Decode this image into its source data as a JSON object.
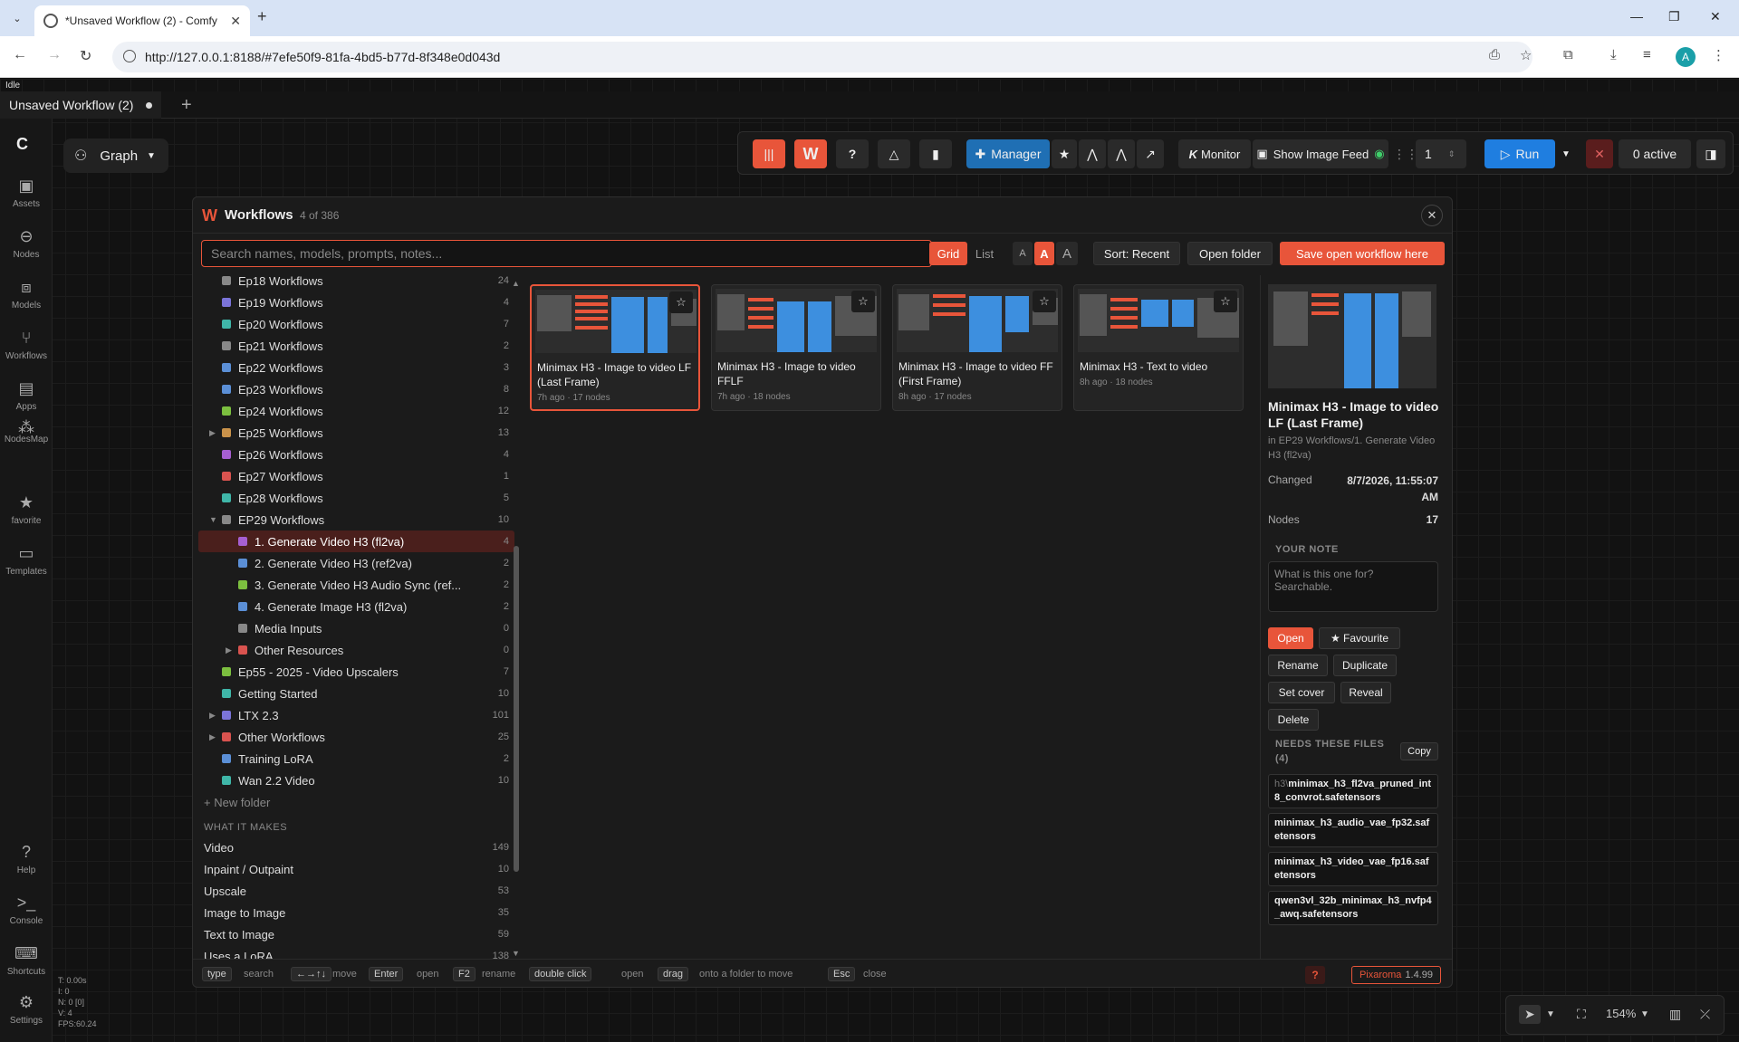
{
  "browser": {
    "tab_title": "*Unsaved Workflow (2) - Comfy",
    "url": "http://127.0.0.1:8188/#7efe50f9-81fa-4bd5-b77d-8f348e0d043d",
    "avatar_letter": "A"
  },
  "app": {
    "status": "Idle",
    "workflow_tab": "Unsaved Workflow (2)",
    "graph_label": "Graph",
    "sidebar": [
      {
        "label": "Assets",
        "icon": "assets-icon"
      },
      {
        "label": "Nodes",
        "icon": "nodes-icon"
      },
      {
        "label": "Models",
        "icon": "models-icon"
      },
      {
        "label": "Workflows",
        "icon": "workflows-icon"
      },
      {
        "label": "Apps",
        "icon": "apps-icon"
      },
      {
        "label": "NodesMap",
        "icon": "nodesmap-icon"
      },
      {
        "label": "favorite",
        "icon": "star-icon"
      },
      {
        "label": "Templates",
        "icon": "templates-icon"
      },
      {
        "label": "Help",
        "icon": "help-icon"
      },
      {
        "label": "Console",
        "icon": "console-icon"
      },
      {
        "label": "Shortcuts",
        "icon": "keyboard-icon"
      },
      {
        "label": "Settings",
        "icon": "gear-icon"
      }
    ],
    "stats": [
      "T: 0.00s",
      "I: 0",
      "N: 0 [0]",
      "V: 4",
      "FPS:60.24"
    ],
    "topbar": {
      "help": "?",
      "manager": "Manager",
      "monitor": "Monitor",
      "monitor_prefix": "K",
      "show_image_feed": "Show Image Feed",
      "batch_count": "1",
      "run": "Run",
      "active": "0 active"
    },
    "zoom": "154%"
  },
  "modal": {
    "title": "Workflows",
    "count": "4 of 386",
    "search_placeholder": "Search names, models, prompts, notes...",
    "view_grid": "Grid",
    "view_list": "List",
    "font_sizes": [
      "A",
      "A",
      "A"
    ],
    "sort": "Sort: Recent",
    "open_folder": "Open folder",
    "save_here": "Save open workflow here",
    "tree": [
      {
        "label": "Ep18 Workflows",
        "count": "24",
        "color": "#888888",
        "level": 0,
        "arrow": ""
      },
      {
        "label": "Ep19 Workflows",
        "count": "4",
        "color": "#7b74d9",
        "level": 0,
        "arrow": ""
      },
      {
        "label": "Ep20 Workflows",
        "count": "7",
        "color": "#3fb6a8",
        "level": 0,
        "arrow": ""
      },
      {
        "label": "Ep21 Workflows",
        "count": "2",
        "color": "#888888",
        "level": 0,
        "arrow": ""
      },
      {
        "label": "Ep22 Workflows",
        "count": "3",
        "color": "#5b8fd6",
        "level": 0,
        "arrow": ""
      },
      {
        "label": "Ep23 Workflows",
        "count": "8",
        "color": "#5b8fd6",
        "level": 0,
        "arrow": ""
      },
      {
        "label": "Ep24 Workflows",
        "count": "12",
        "color": "#7cbf3f",
        "level": 0,
        "arrow": ""
      },
      {
        "label": "Ep25 Workflows",
        "count": "13",
        "color": "#c9924a",
        "level": 0,
        "arrow": "▶"
      },
      {
        "label": "Ep26 Workflows",
        "count": "4",
        "color": "#a65fd1",
        "level": 0,
        "arrow": ""
      },
      {
        "label": "Ep27 Workflows",
        "count": "1",
        "color": "#d9534f",
        "level": 0,
        "arrow": ""
      },
      {
        "label": "Ep28 Workflows",
        "count": "5",
        "color": "#3fb6a8",
        "level": 0,
        "arrow": ""
      },
      {
        "label": "EP29 Workflows",
        "count": "10",
        "color": "#888888",
        "level": 0,
        "arrow": "▼"
      },
      {
        "label": "1. Generate Video H3 (fl2va)",
        "count": "4",
        "color": "#a65fd1",
        "level": 1,
        "arrow": "",
        "selected": true
      },
      {
        "label": "2. Generate Video H3 (ref2va)",
        "count": "2",
        "color": "#5b8fd6",
        "level": 1,
        "arrow": ""
      },
      {
        "label": "3. Generate Video H3 Audio Sync (ref...",
        "count": "2",
        "color": "#7cbf3f",
        "level": 1,
        "arrow": ""
      },
      {
        "label": "4. Generate Image H3 (fl2va)",
        "count": "2",
        "color": "#5b8fd6",
        "level": 1,
        "arrow": ""
      },
      {
        "label": "Media Inputs",
        "count": "0",
        "color": "#888888",
        "level": 1,
        "arrow": ""
      },
      {
        "label": "Other Resources",
        "count": "0",
        "color": "#d9534f",
        "level": 1,
        "arrow": "▶"
      },
      {
        "label": "Ep55 - 2025 - Video Upscalers",
        "count": "7",
        "color": "#7cbf3f",
        "level": 0,
        "arrow": ""
      },
      {
        "label": "Getting Started",
        "count": "10",
        "color": "#3fb6a8",
        "level": 0,
        "arrow": ""
      },
      {
        "label": "LTX 2.3",
        "count": "101",
        "color": "#7b74d9",
        "level": 0,
        "arrow": "▶"
      },
      {
        "label": "Other Workflows",
        "count": "25",
        "color": "#d9534f",
        "level": 0,
        "arrow": "▶"
      },
      {
        "label": "Training LoRA",
        "count": "2",
        "color": "#5b8fd6",
        "level": 0,
        "arrow": ""
      },
      {
        "label": "Wan 2.2 Video",
        "count": "10",
        "color": "#3fb6a8",
        "level": 0,
        "arrow": ""
      }
    ],
    "new_folder": "+ New folder",
    "what_it_makes_title": "WHAT IT MAKES",
    "what_it_makes": [
      {
        "label": "Video",
        "count": "149"
      },
      {
        "label": "Inpaint / Outpaint",
        "count": "10"
      },
      {
        "label": "Upscale",
        "count": "53"
      },
      {
        "label": "Image to Image",
        "count": "35"
      },
      {
        "label": "Text to Image",
        "count": "59"
      },
      {
        "label": "Uses a LoRA",
        "count": "138"
      }
    ],
    "cards": [
      {
        "title": "Minimax H3 - Image to video LF (Last Frame)",
        "meta": "7h ago · 17 nodes",
        "selected": true
      },
      {
        "title": "Minimax H3 - Image to video FFLF",
        "meta": "7h ago · 18 nodes",
        "selected": false
      },
      {
        "title": "Minimax H3 - Image to video FF (First Frame)",
        "meta": "8h ago · 17 nodes",
        "selected": false
      },
      {
        "title": "Minimax H3 - Text to video",
        "meta": "8h ago · 18 nodes",
        "selected": false
      }
    ],
    "details": {
      "title": "Minimax H3 - Image to video LF (Last Frame)",
      "path": "in EP29 Workflows/1. Generate Video H3 (fl2va)",
      "changed_label": "Changed",
      "changed_value": "8/7/2026, 11:55:07 AM",
      "nodes_label": "Nodes",
      "nodes_value": "17",
      "note_label": "YOUR NOTE",
      "note_placeholder": "What is this one for? Searchable.",
      "open": "Open",
      "favourite": "★ Favourite",
      "rename": "Rename",
      "duplicate": "Duplicate",
      "set_cover": "Set cover",
      "reveal": "Reveal",
      "delete": "Delete",
      "needs_files_label": "NEEDS THESE FILES (4)",
      "copy": "Copy",
      "files": [
        {
          "prefix": "h3\\",
          "name": "minimax_h3_fl2va_pruned_int8_convrot.safetensors"
        },
        {
          "prefix": "",
          "name": "minimax_h3_audio_vae_fp32.safetensors"
        },
        {
          "prefix": "",
          "name": "minimax_h3_video_vae_fp16.safetensors"
        },
        {
          "prefix": "",
          "name": "qwen3vl_32b_minimax_h3_nvfp4_awq.safetensors"
        }
      ]
    },
    "footer": {
      "hints": [
        {
          "key": "type",
          "text": "search"
        },
        {
          "key": "←→↑↓",
          "text": "move"
        },
        {
          "key": "Enter",
          "text": "open"
        },
        {
          "key": "F2",
          "text": "rename"
        },
        {
          "key": "double click",
          "text": "open"
        },
        {
          "key": "drag",
          "text": "onto a folder to move"
        },
        {
          "key": "Esc",
          "text": "close"
        }
      ],
      "help": "?",
      "brand": "Pixaroma",
      "version": "1.4.99"
    }
  }
}
